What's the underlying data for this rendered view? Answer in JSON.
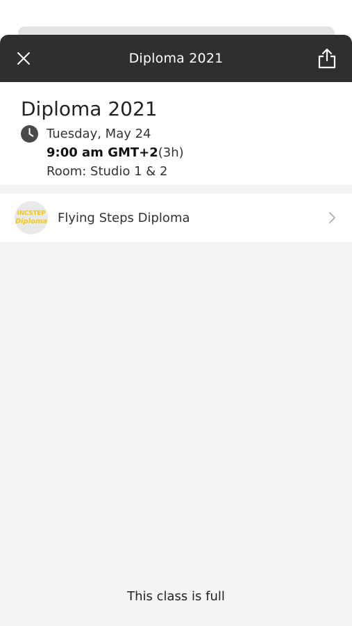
{
  "header": {
    "title": "Diploma 2021",
    "close_icon": "close-icon",
    "share_icon": "share-icon"
  },
  "class_info": {
    "title": "Diploma 2021",
    "date": "Tuesday, May 24",
    "time": "9:00 am GMT+2",
    "duration": "(3h)",
    "room": "Room: Studio 1 & 2"
  },
  "event": {
    "name": "Flying Steps Diploma",
    "logo_text_top": "INCSTEP",
    "logo_text_bottom": "Diploma"
  },
  "footer": {
    "status": "This class is full"
  },
  "colors": {
    "header_bg": "#2f2f2f",
    "logo_accent": "#f2c811",
    "sheet_bg": "#f4f5f6"
  }
}
